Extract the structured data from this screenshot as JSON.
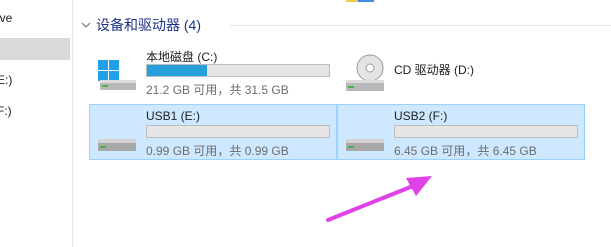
{
  "navigation": {
    "items": [
      {
        "label": "ive",
        "selected": false
      },
      {
        "label": "",
        "selected": true
      },
      {
        "label": "E:)",
        "selected": false
      },
      {
        "label": "F:)",
        "selected": false
      }
    ]
  },
  "devices_group": {
    "header": "设备和驱动器 (4)"
  },
  "drives": [
    {
      "name": "本地磁盘 (C:)",
      "space": "21.2 GB 可用，共 31.5 GB",
      "used_fraction": 0.327,
      "icon": "windows-drive-icon",
      "selected": false
    },
    {
      "name": "CD 驱动器 (D:)",
      "space": "",
      "used_fraction": null,
      "icon": "cd-drive-icon",
      "selected": false
    },
    {
      "name": "USB1 (E:)",
      "space": "0.99 GB 可用，共 0.99 GB",
      "used_fraction": 0.0,
      "icon": "usb-drive-icon",
      "selected": true
    },
    {
      "name": "USB2 (F:)",
      "space": "6.45 GB 可用，共 6.45 GB",
      "used_fraction": 0.0,
      "icon": "usb-drive-icon",
      "selected": true
    }
  ],
  "colors": {
    "selection_bg": "#cde8ff",
    "selection_border": "#99d1ff",
    "bar_fill": "#26a0da",
    "header_text": "#1e3287",
    "annotation_arrow": "#e040e8"
  }
}
